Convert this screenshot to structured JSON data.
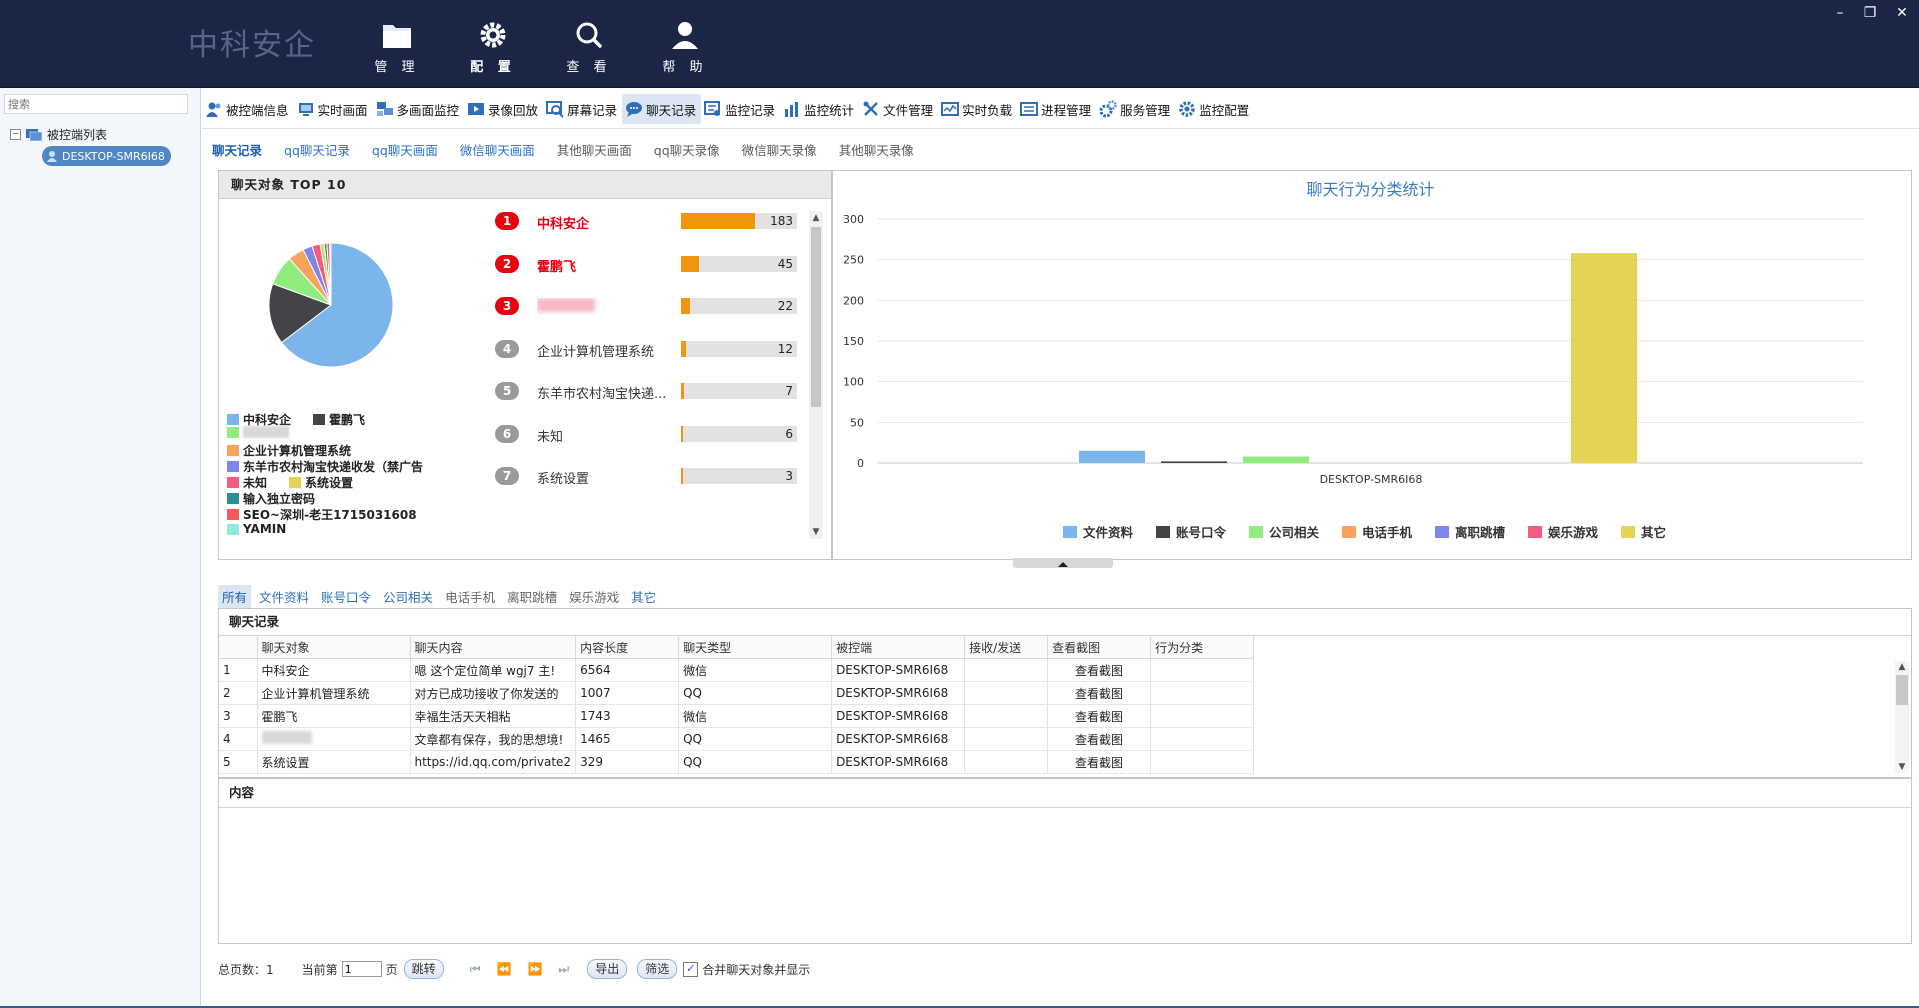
{
  "header": {
    "logo": "中科安企",
    "nav": [
      {
        "label": "管 理",
        "icon": "folder-icon"
      },
      {
        "label": "配 置",
        "icon": "gear-icon"
      },
      {
        "label": "查 看",
        "icon": "search-icon"
      },
      {
        "label": "帮 助",
        "icon": "user-icon"
      }
    ],
    "window": {
      "minimize": "–",
      "restore": "❐",
      "close": "✕"
    }
  },
  "sidebar": {
    "search_placeholder": "搜索",
    "tree_root": "被控端列表",
    "tree_node": "DESKTOP-SMR6I68"
  },
  "toolbar": {
    "items": [
      {
        "label": "被控端信息",
        "icon": "users-icon"
      },
      {
        "label": "实时画面",
        "icon": "monitor-icon"
      },
      {
        "label": "多画面监控",
        "icon": "multi-monitor-icon"
      },
      {
        "label": "录像回放",
        "icon": "video-icon"
      },
      {
        "label": "屏幕记录",
        "icon": "screen-record-icon"
      },
      {
        "label": "聊天记录",
        "icon": "chat-icon"
      },
      {
        "label": "监控记录",
        "icon": "log-icon"
      },
      {
        "label": "监控统计",
        "icon": "stats-icon"
      },
      {
        "label": "文件管理",
        "icon": "tools-icon"
      },
      {
        "label": "实时负载",
        "icon": "load-icon"
      },
      {
        "label": "进程管理",
        "icon": "process-icon"
      },
      {
        "label": "服务管理",
        "icon": "service-icon"
      },
      {
        "label": "监控配置",
        "icon": "gear-icon"
      }
    ],
    "active_index": 5
  },
  "subtabs": [
    "聊天记录",
    "qq聊天记录",
    "qq聊天画面",
    "微信聊天画面",
    "其他聊天画面",
    "qq聊天录像",
    "微信聊天录像",
    "其他聊天录像"
  ],
  "top10": {
    "title": "聊天对象  TOP 10",
    "legend": [
      {
        "label": "中科安企",
        "color": "#7cb5ec"
      },
      {
        "label": "霍鹏飞",
        "color": "#434348"
      },
      {
        "label": "",
        "color": "#90ed7d"
      },
      {
        "label": "企业计算机管理系统",
        "color": "#f7a35c"
      },
      {
        "label": "东羊市农村淘宝快递收发（禁广告",
        "color": "#8085e9"
      },
      {
        "label": "未知",
        "color": "#f15c80"
      },
      {
        "label": "系统设置",
        "color": "#e4d354"
      },
      {
        "label": "输入独立密码",
        "color": "#2b908f"
      },
      {
        "label": "SEO~深圳-老王1715031608",
        "color": "#f45b5b"
      },
      {
        "label": "YAMIN",
        "color": "#91e8e1"
      }
    ],
    "ranks": [
      {
        "rank": "1",
        "name": "中科安企",
        "value": 183,
        "highlight": true
      },
      {
        "rank": "2",
        "name": "霍鹏飞",
        "value": 45,
        "highlight": true
      },
      {
        "rank": "3",
        "name": "",
        "value": 22,
        "highlight": true
      },
      {
        "rank": "4",
        "name": "企业计算机管理系统",
        "value": 12,
        "highlight": false
      },
      {
        "rank": "5",
        "name": "东羊市农村淘宝快递...",
        "value": 7,
        "highlight": false
      },
      {
        "rank": "6",
        "name": "未知",
        "value": 6,
        "highlight": false
      },
      {
        "rank": "7",
        "name": "系统设置",
        "value": 3,
        "highlight": false
      }
    ],
    "max": 183,
    "pie_values": [
      183,
      45,
      22,
      12,
      7,
      6,
      3,
      2,
      2,
      1
    ],
    "pie_colors": [
      "#7cb5ec",
      "#434348",
      "#90ed7d",
      "#f7a35c",
      "#8085e9",
      "#f15c80",
      "#e4d354",
      "#2b908f",
      "#f45b5b",
      "#91e8e1"
    ]
  },
  "chart_data": {
    "type": "bar",
    "title": "聊天行为分类统计",
    "categories": [
      "DESKTOP-SMR6I68"
    ],
    "series": [
      {
        "name": "文件资料",
        "values": [
          15
        ],
        "color": "#7cb5ec"
      },
      {
        "name": "账号口令",
        "values": [
          2
        ],
        "color": "#434348"
      },
      {
        "name": "公司相关",
        "values": [
          8
        ],
        "color": "#90ed7d"
      },
      {
        "name": "电话手机",
        "values": [
          0
        ],
        "color": "#f7a35c"
      },
      {
        "name": "离职跳槽",
        "values": [
          0
        ],
        "color": "#8085e9"
      },
      {
        "name": "娱乐游戏",
        "values": [
          0
        ],
        "color": "#f15c80"
      },
      {
        "name": "其它",
        "values": [
          258
        ],
        "color": "#e4d354"
      }
    ],
    "ylim": [
      0,
      300
    ],
    "yticks": [
      "0",
      "50",
      "100",
      "150",
      "200",
      "250",
      "300"
    ],
    "grid": true,
    "legend": "bottom"
  },
  "category_tabs": [
    "所有",
    "文件资料",
    "账号口令",
    "公司相关",
    "电话手机",
    "离职跳槽",
    "娱乐游戏",
    "其它"
  ],
  "chat_table": {
    "title": "聊天记录",
    "columns": [
      "",
      "聊天对象",
      "聊天内容",
      "内容长度",
      "聊天类型",
      "被控端",
      "接收/发送",
      "查看截图",
      "行为分类"
    ],
    "rows": [
      [
        "1",
        "中科安企",
        "嗯 这个定位简单   wgj7 主!",
        "6564",
        "微信",
        "DESKTOP-SMR6I68",
        "",
        "查看截图",
        ""
      ],
      [
        "2",
        "企业计算机管理系统",
        "对方已成功接收了你发送的",
        "1007",
        "QQ",
        "DESKTOP-SMR6I68",
        "",
        "查看截图",
        ""
      ],
      [
        "3",
        "霍鹏飞",
        "幸福生活天天相粘",
        "1743",
        "微信",
        "DESKTOP-SMR6I68",
        "",
        "查看截图",
        ""
      ],
      [
        "4",
        "",
        "文章都有保存，我的思想境!",
        "1465",
        "QQ",
        "DESKTOP-SMR6I68",
        "",
        "查看截图",
        ""
      ],
      [
        "5",
        "系统设置",
        "https://id.qq.com/private2",
        "329",
        "QQ",
        "DESKTOP-SMR6I68",
        "",
        "查看截图",
        ""
      ]
    ]
  },
  "content_panel": {
    "title": "内容"
  },
  "pager": {
    "total_label": "总页数：1",
    "current_label": "当前第",
    "page_value": "1",
    "page_unit": "页",
    "jump": "跳转",
    "export": "导出",
    "filter": "筛选",
    "merge_label": "合并聊天对象并显示",
    "merge_checked": true
  }
}
